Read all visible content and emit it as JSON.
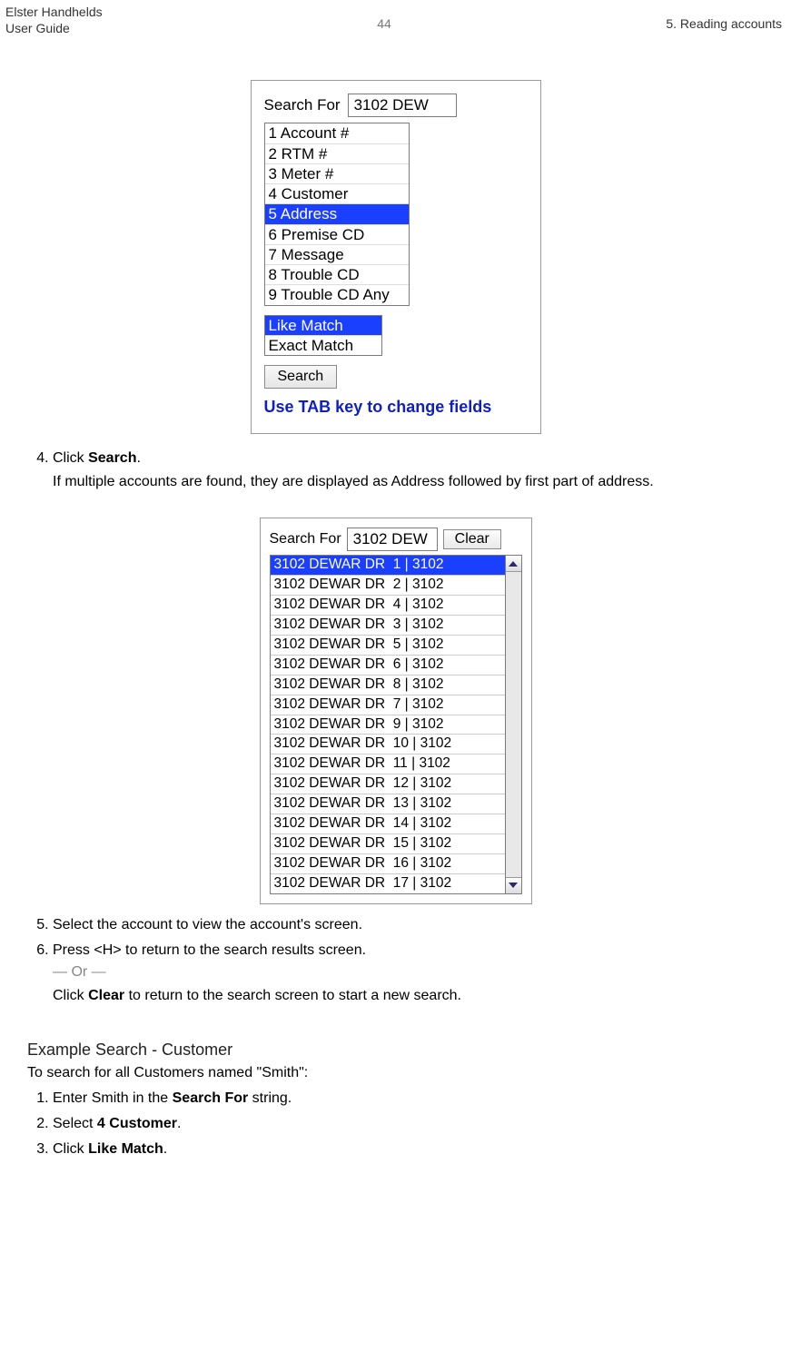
{
  "header": {
    "left_line1": "Elster Handhelds",
    "left_line2": "User Guide",
    "center": "44",
    "right": "5. Reading accounts"
  },
  "figure1": {
    "search_label": "Search For",
    "search_value": "3102 DEW",
    "options": [
      "1 Account #",
      "2 RTM #",
      "3 Meter #",
      "4 Customer",
      "5 Address",
      "6 Premise CD",
      "7 Message",
      "8 Trouble CD",
      "9 Trouble CD Any"
    ],
    "selected_index": 4,
    "match_options": [
      "Like Match",
      "Exact Match"
    ],
    "match_selected_index": 0,
    "search_button": "Search",
    "helper": "Use TAB key to change fields"
  },
  "steps_a": {
    "start": 4,
    "step4_a": "Click ",
    "step4_bold": "Search",
    "step4_b": ".",
    "step4_sub": "If multiple accounts are found, they are displayed as Address followed by first part of address."
  },
  "figure2": {
    "search_label": "Search For",
    "search_value": "3102 DEW",
    "clear_button": "Clear",
    "rows": [
      "3102 DEWAR DR  1 | 3102",
      "3102 DEWAR DR  2 | 3102",
      "3102 DEWAR DR  4 | 3102",
      "3102 DEWAR DR  3 | 3102",
      "3102 DEWAR DR  5 | 3102",
      "3102 DEWAR DR  6 | 3102",
      "3102 DEWAR DR  8 | 3102",
      "3102 DEWAR DR  7 | 3102",
      "3102 DEWAR DR  9 | 3102",
      "3102 DEWAR DR  10 | 3102",
      "3102 DEWAR DR  11 | 3102",
      "3102 DEWAR DR  12 | 3102",
      "3102 DEWAR DR  13 | 3102",
      "3102 DEWAR DR  14 | 3102",
      "3102 DEWAR DR  15 | 3102",
      "3102 DEWAR DR  16 | 3102",
      "3102 DEWAR DR  17 | 3102"
    ],
    "selected_index": 0
  },
  "steps_b": {
    "start": 5,
    "step5": "Select the account to view the account's screen.",
    "step6": "Press <H> to return to the search results screen.",
    "or": "— Or —",
    "step6_sub_a": "Click ",
    "step6_sub_bold": "Clear",
    "step6_sub_b": " to return to the search screen to start a new search."
  },
  "section": {
    "heading": "Example Search - Customer",
    "intro": "To search for all Customers named \"Smith\":",
    "s1_a": "Enter Smith in the ",
    "s1_bold": "Search For",
    "s1_b": " string.",
    "s2_a": "Select ",
    "s2_bold": "4 Customer",
    "s2_b": ".",
    "s3_a": "Click ",
    "s3_bold": "Like Match",
    "s3_b": "."
  }
}
